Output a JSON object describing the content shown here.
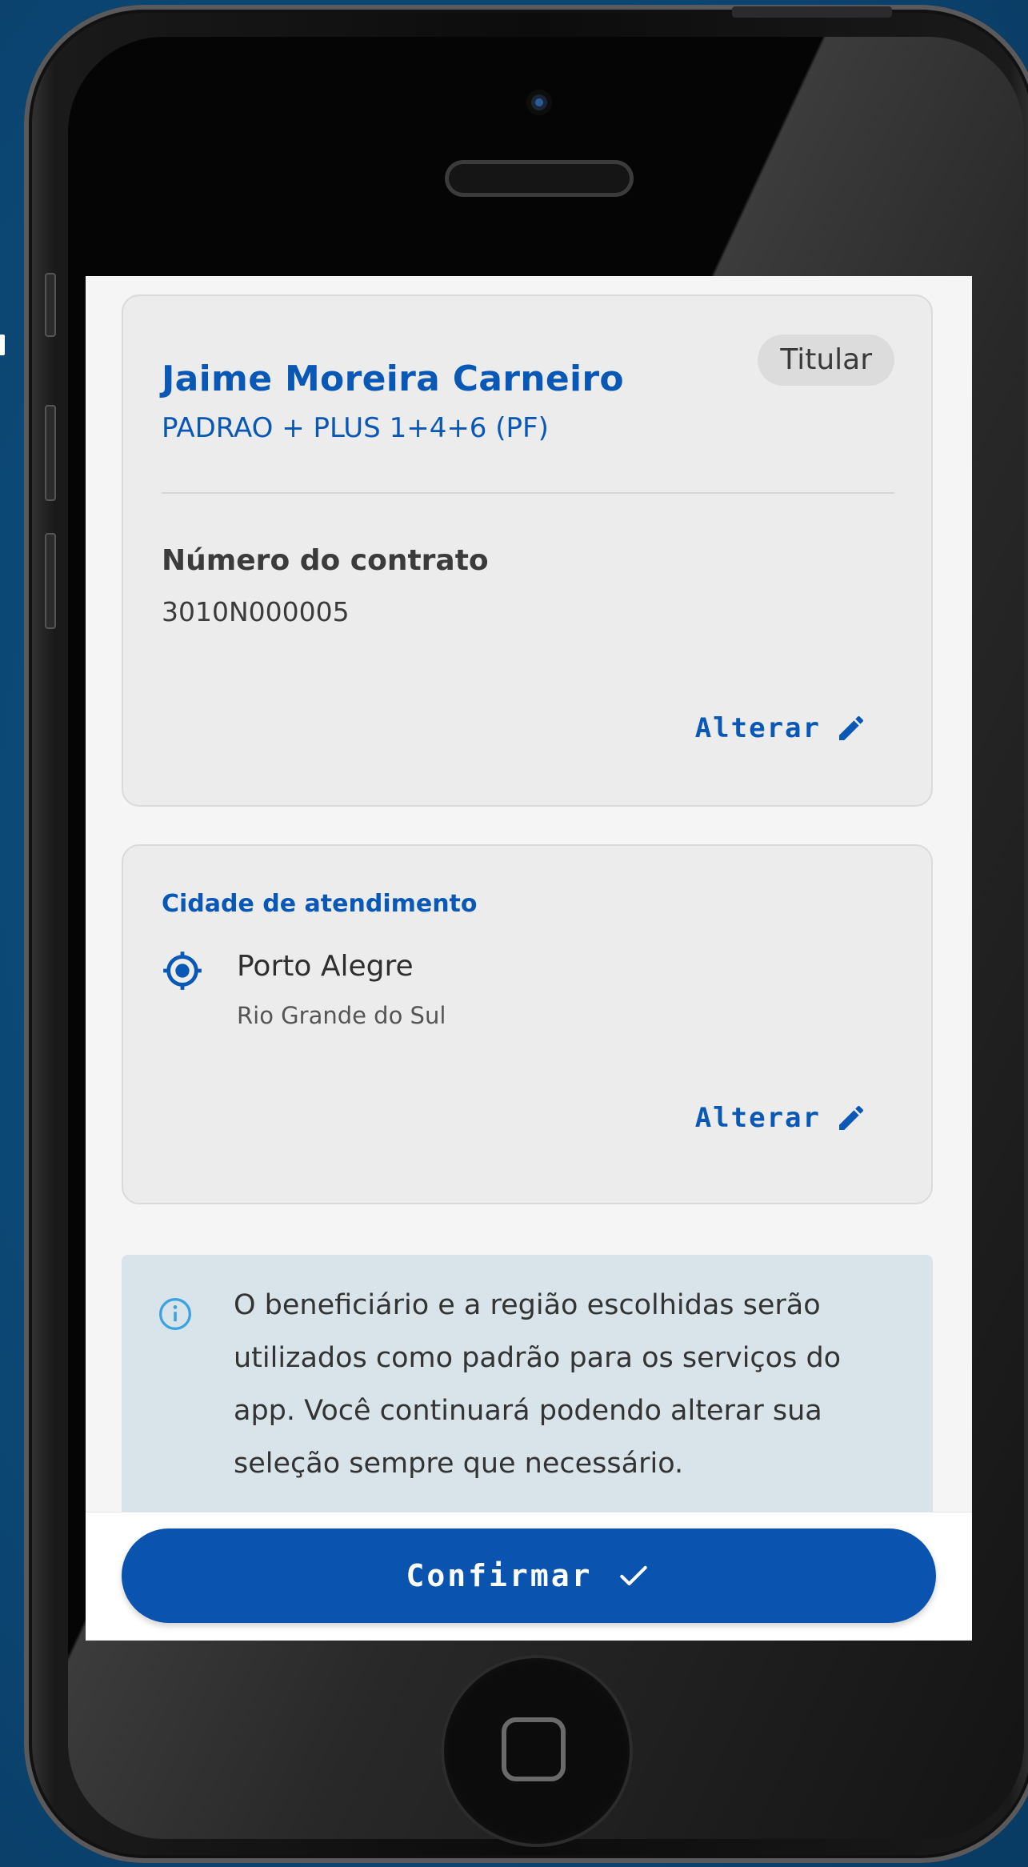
{
  "card_holder": {
    "name": "Jaime Moreira Carneiro",
    "badge": "Titular",
    "plan": "PADRAO + PLUS 1+4+6 (PF)",
    "contract_label": "Número do contrato",
    "contract_number": "3010N000005",
    "alter_label": "Alterar",
    "alter_icon": "pencil-icon"
  },
  "city_card": {
    "label": "Cidade de atendimento",
    "location_icon": "location-target-icon",
    "city": "Porto Alegre",
    "state": "Rio  Grande do Sul",
    "alter_label": "Alterar",
    "alter_icon": "pencil-icon"
  },
  "info": {
    "icon": "info-icon",
    "text": "O beneficiário e a região escolhidas serão utilizados como padrão para os serviços do app. Você continuará podendo alterar sua seleção sempre que necessário."
  },
  "footer": {
    "confirm_label": "Confirmar",
    "confirm_icon": "check-icon"
  },
  "colors": {
    "primary": "#0a54b0",
    "background": "#0d4a78",
    "card": "#ececec",
    "info_bg": "#d8e4ea"
  }
}
